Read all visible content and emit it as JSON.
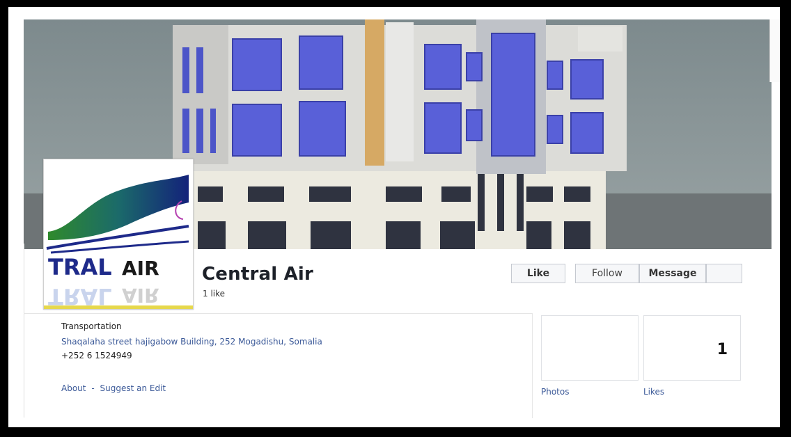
{
  "page": {
    "name": "Central Air",
    "like_count": "1 like",
    "category": "Transportation",
    "address": "Shaqalaha street hajigabow Building, 252 Mogadishu, Somalia",
    "phone": "+252 6 1524949"
  },
  "logo": {
    "line1": "TRAL",
    "line2": "AIR"
  },
  "actions": {
    "like": "Like",
    "follow": "Follow",
    "message": "Message"
  },
  "links": {
    "about": "About",
    "separator": "-",
    "suggest_edit": "Suggest an Edit"
  },
  "tiles": {
    "photos_label": "Photos",
    "likes_label": "Likes",
    "likes_value": "1"
  },
  "colors": {
    "link": "#3b5998",
    "window_blue": "#5a63d4"
  }
}
